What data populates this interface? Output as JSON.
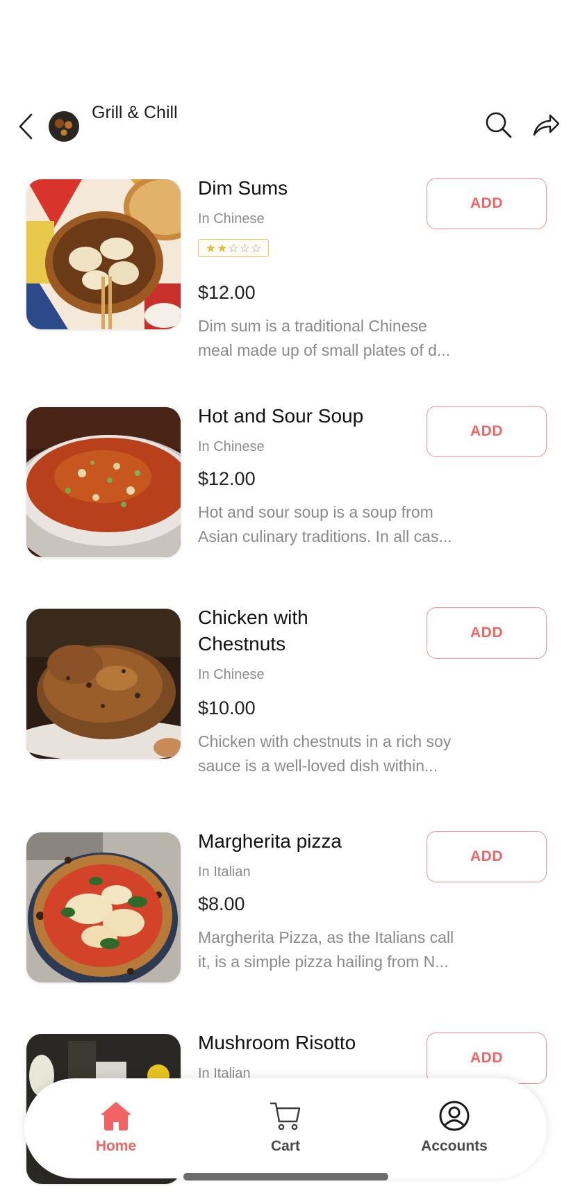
{
  "header": {
    "restaurant_name": "Grill & Chill",
    "back_icon": "chevron-left-icon",
    "search_icon": "search-icon",
    "share_icon": "share-icon"
  },
  "items": [
    {
      "name": "Dim Sums",
      "category": "In Chinese",
      "rating": 2,
      "rating_max": 5,
      "price": "$12.00",
      "description_line1": "Dim sum is a traditional Chinese",
      "description_line2": "meal made up of small plates of d...",
      "add_label": "ADD"
    },
    {
      "name": "Hot and Sour Soup",
      "category": "In Chinese",
      "price": "$12.00",
      "description_line1": "Hot and sour soup is a soup from",
      "description_line2": "Asian culinary traditions. In all cas...",
      "add_label": "ADD"
    },
    {
      "name_line1": "Chicken with",
      "name_line2": "Chestnuts",
      "category": "In Chinese",
      "price": "$10.00",
      "description_line1": "Chicken with chestnuts in a rich soy",
      "description_line2": "sauce is a well-loved dish within...",
      "add_label": "ADD"
    },
    {
      "name": "Margherita pizza",
      "category": "In Italian",
      "price": "$8.00",
      "description_line1": "Margherita Pizza, as the Italians call",
      "description_line2": "it, is a simple pizza hailing from N...",
      "add_label": "ADD"
    },
    {
      "name": "Mushroom Risotto",
      "category": "In Italian",
      "add_label": "ADD"
    }
  ],
  "nav": {
    "home_label": "Home",
    "cart_label": "Cart",
    "accounts_label": "Accounts",
    "active": "Home"
  },
  "colors": {
    "accent": "#f26464",
    "add_border": "#f29090",
    "star": "#e5b93a"
  }
}
